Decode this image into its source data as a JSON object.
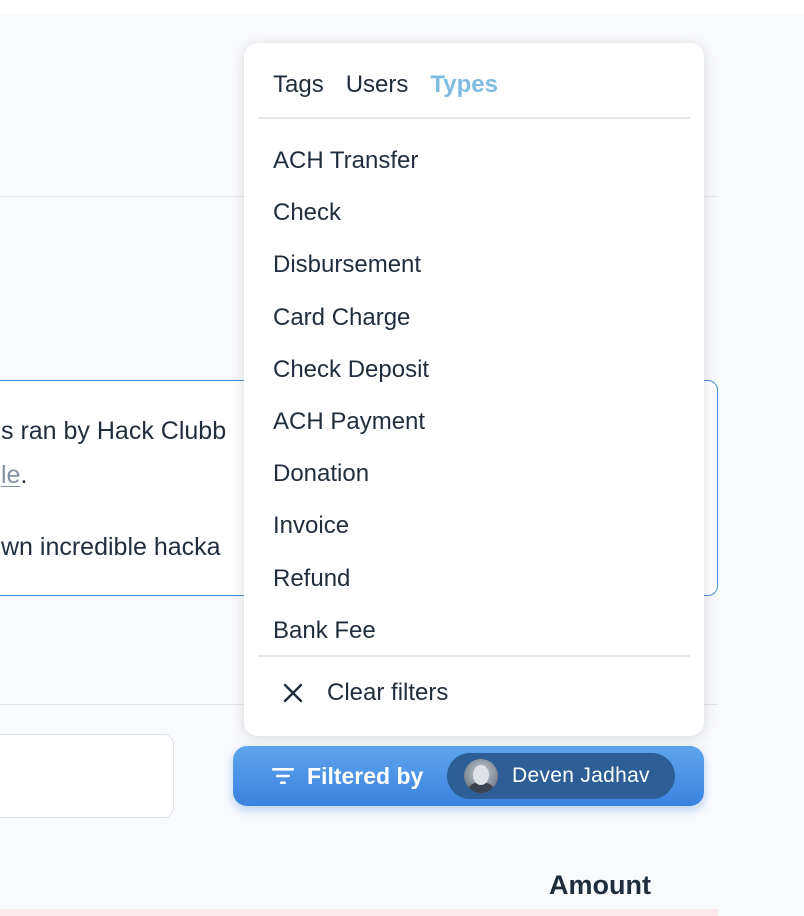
{
  "notice": {
    "line1": "s ran by Hack Clubb",
    "line2_link": "le",
    "line2_period": ".",
    "line3": "wn incredible hacka"
  },
  "table": {
    "amount_header": "Amount"
  },
  "filter_menu": {
    "tabs": [
      {
        "label": "Tags",
        "active": false
      },
      {
        "label": "Users",
        "active": false
      },
      {
        "label": "Types",
        "active": true
      }
    ],
    "items": [
      {
        "label": "ACH Transfer"
      },
      {
        "label": "Check"
      },
      {
        "label": "Disbursement"
      },
      {
        "label": "Card Charge"
      },
      {
        "label": "Check Deposit"
      },
      {
        "label": "ACH Payment"
      },
      {
        "label": "Donation"
      },
      {
        "label": "Invoice"
      },
      {
        "label": "Refund"
      },
      {
        "label": "Bank Fee"
      }
    ],
    "clear_label": "Clear filters",
    "clear_icon": "close-icon"
  },
  "filter_button": {
    "label": "Filtered by",
    "icon": "filter-icon",
    "user_name": "Deven Jadhav",
    "avatar_icon": "avatar"
  },
  "colors": {
    "accent": "#4a90e2",
    "active_tab": "#7fbbe0",
    "chip_bg": "#2d5f96",
    "text": "#1f2d3d"
  }
}
